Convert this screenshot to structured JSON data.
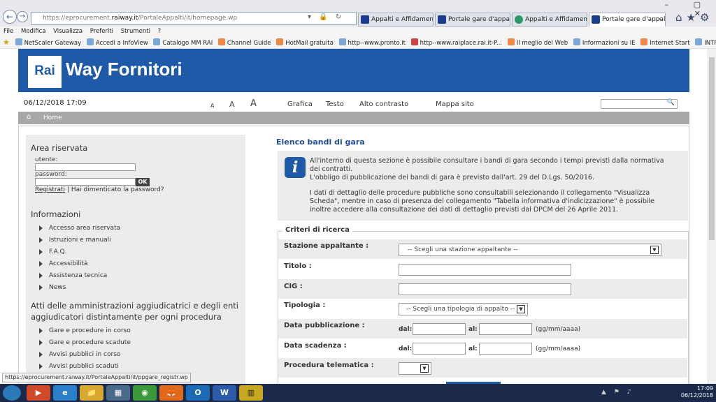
{
  "browser": {
    "address_prefix": "https://eprocurement.",
    "address_domain": "raiway.it",
    "address_suffix": "/PortaleAppalti/it/homepage.wp",
    "addr_icons": "▾ 🔒 ↻",
    "tabs": [
      {
        "label": "Appalti e Affidamenti"
      },
      {
        "label": "Portale gare d'appalto"
      },
      {
        "label": "Appalti e Affidamenti"
      },
      {
        "label": "Portale gare d'appalto"
      }
    ],
    "close_glyph": "×",
    "window_buttons": "– ▢ ✕",
    "right_buttons": "⌂★⚙",
    "menu": [
      "File",
      "Modifica",
      "Visualizza",
      "Preferiti",
      "Strumenti",
      "?"
    ],
    "favorites": [
      "NetScaler Gateway",
      "Accedi a InfoView",
      "Catalogo MM RAI",
      "Channel Guide",
      "HotMail gratuita",
      "http--www.pronto.it",
      "http--www.raiplace.rai.it-P...",
      "Il meglio del Web",
      "Informazioni su IE",
      "Internet Start",
      "INTRANET"
    ]
  },
  "header": {
    "logo": "Rai",
    "brand": "Way Fornitori",
    "date": "06/12/2018 17:09",
    "text_sizes": [
      "A",
      "A",
      "A"
    ],
    "links": [
      "Grafica",
      "Testo",
      "Alto contrasto",
      "Mappa sito"
    ],
    "search_glyph": "🔍",
    "home_label": "Home"
  },
  "sidebar": {
    "area_title": "Area riservata",
    "user_label": "utente:",
    "password_label": "password:",
    "ok_label": "OK",
    "register_label": "Registrati",
    "separator": "|",
    "forgot_label": "Hai dimenticato la password?",
    "info_title": "Informazioni",
    "info_items": [
      "Accesso area riservata",
      "Istruzioni e manuali",
      "F.A.Q.",
      "Accessibilità",
      "Assistenza tecnica",
      "News"
    ],
    "atti_title_1": "Atti delle amministrazioni aggiudicatrici e degli enti",
    "atti_title_2": "aggiudicatori distintamente per ogni procedura",
    "atti_items": [
      "Gare e procedure in corso",
      "Gare e procedure scadute",
      "Avvisi pubblici in corso",
      "Avvisi pubblici scaduti"
    ]
  },
  "main": {
    "title": "Elenco bandi di gara",
    "info_icon": "i",
    "info_lines": [
      "All'interno di questa sezione è possibile consultare i bandi di gara secondo i tempi previsti dalla normativa",
      "dei contratti.",
      "L'obbligo di pubblicazione dei bandi di gara è previsto dall'art. 29 del D.Lgs. 50/2016.",
      "I dati di dettaglio delle procedure pubbliche sono consultabili selezionando il collegamento \"Visualizza",
      "Scheda\", mentre in caso di presenza del collegamento \"Tabella informativa d'indicizzazione\" è possibile",
      "inoltre accedere alla consultazione dei dati di dettaglio previsti dal DPCM del 26 Aprile 2011."
    ],
    "criteria_title": "Criteri di ricerca",
    "fields": {
      "stazione": {
        "label": "Stazione appaltante :",
        "value": "-- Scegli una stazione appaltante --"
      },
      "titolo": {
        "label": "Titolo :",
        "value": ""
      },
      "cig": {
        "label": "CIG :",
        "value": ""
      },
      "tipologia": {
        "label": "Tipologia :",
        "value": "-- Scegli una tipologia di appalto --"
      },
      "data_pubblicazione": {
        "label": "Data pubblicazione :",
        "dal": "dal:",
        "al": "al:",
        "format": "(gg/mm/aaaa)"
      },
      "data_scadenza": {
        "label": "Data scadenza :",
        "dal": "dal:",
        "al": "al:",
        "format": "(gg/mm/aaaa)"
      },
      "procedura": {
        "label": "Procedura telematica :",
        "value": ""
      }
    }
  },
  "status_url": "https://eprocurement.raiway.it/PortaleAppalti/it/ppgare_registr.wp",
  "taskbar": {
    "apps": [
      "▶",
      "e",
      "📁",
      "▦",
      "◉",
      "🦊",
      "O",
      "W",
      "▥"
    ],
    "tray": "▲ ⚑ ♪",
    "time": "17:09",
    "date": "06/12/2018"
  }
}
